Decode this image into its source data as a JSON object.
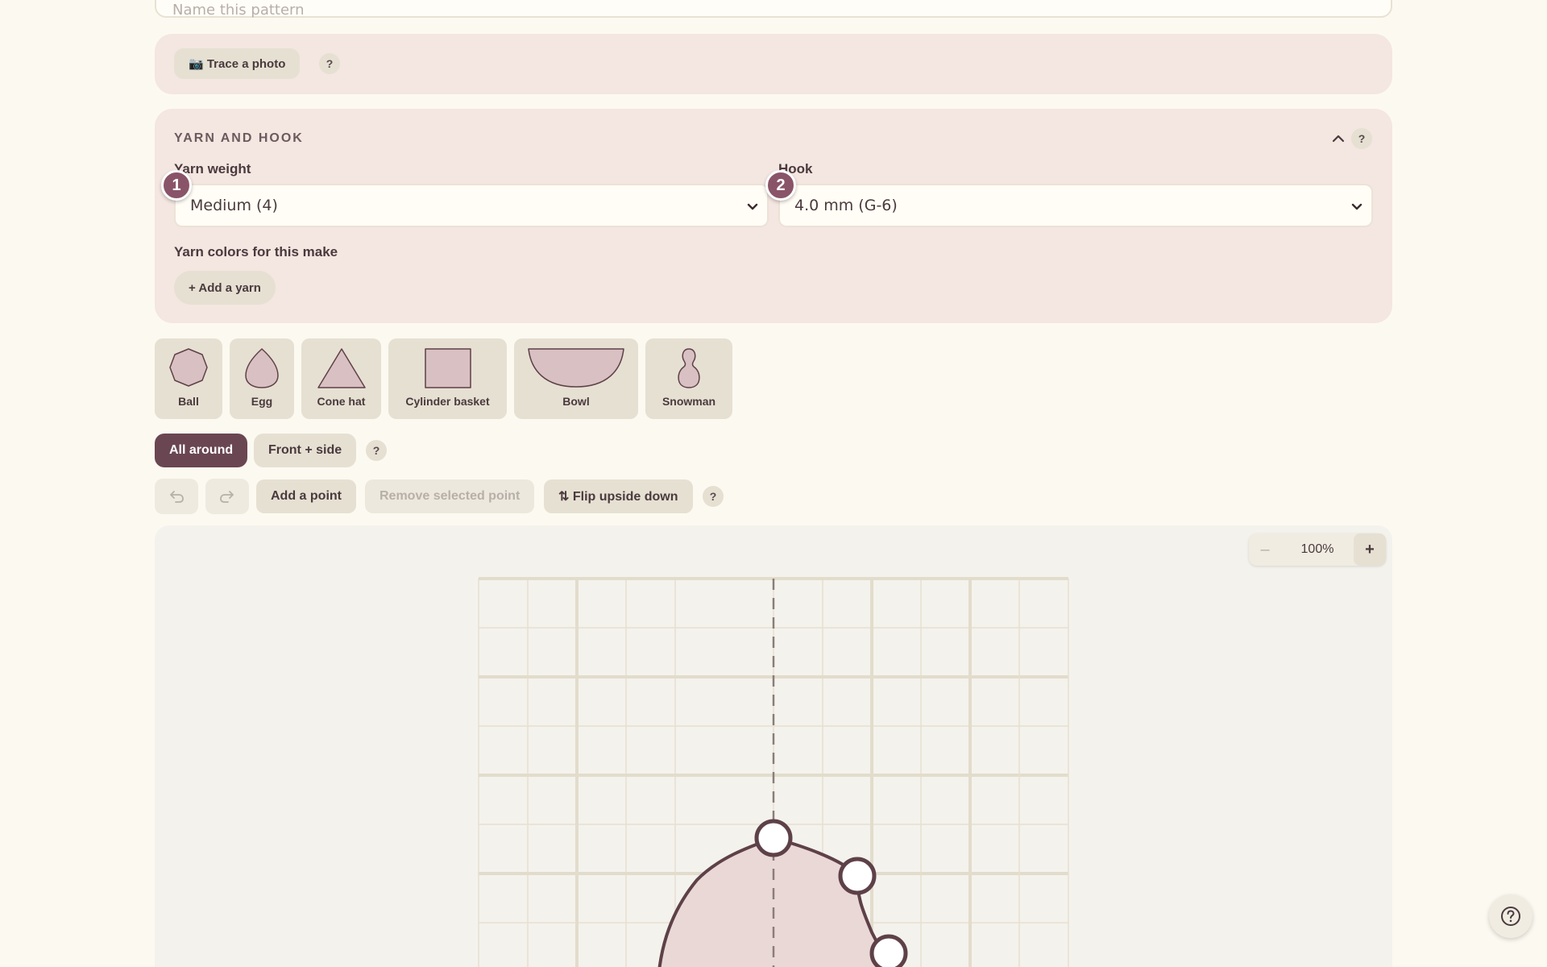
{
  "pattern_name": {
    "placeholder": "Name this pattern"
  },
  "trace": {
    "button_label": "📷 Trace a photo",
    "help": "?"
  },
  "yarn_section": {
    "title": "YARN AND HOOK",
    "help": "?",
    "yarn_weight": {
      "label": "Yarn weight",
      "value": "Medium (4)",
      "step": "1"
    },
    "hook": {
      "label": "Hook",
      "value": "4.0 mm (G-6)",
      "step": "2"
    },
    "colors_label": "Yarn colors for this make",
    "add_yarn": "+ Add a yarn"
  },
  "presets": [
    {
      "label": "Ball",
      "icon": "ball-icon"
    },
    {
      "label": "Egg",
      "icon": "egg-icon"
    },
    {
      "label": "Cone hat",
      "icon": "cone-icon"
    },
    {
      "label": "Cylinder basket",
      "icon": "cylinder-icon"
    },
    {
      "label": "Bowl",
      "icon": "bowl-icon"
    },
    {
      "label": "Snowman",
      "icon": "snowman-icon"
    }
  ],
  "view_toggle": {
    "all_around": "All around",
    "front_side": "Front + side",
    "help": "?"
  },
  "toolbar": {
    "undo": "undo-icon",
    "redo": "redo-icon",
    "add_point": "Add a point",
    "remove_point": "Remove selected point",
    "flip": "⇅ Flip upside down",
    "help": "?"
  },
  "zoom": {
    "minus": "–",
    "value": "100%",
    "plus": "+"
  },
  "colors": {
    "accent": "#6a4652",
    "badge": "#8a5468",
    "card_bg": "#f4e6e0",
    "chip_bg": "#e6e0d2",
    "shape_fill": "#d9c0c2",
    "shape_stroke": "#5e4148"
  }
}
